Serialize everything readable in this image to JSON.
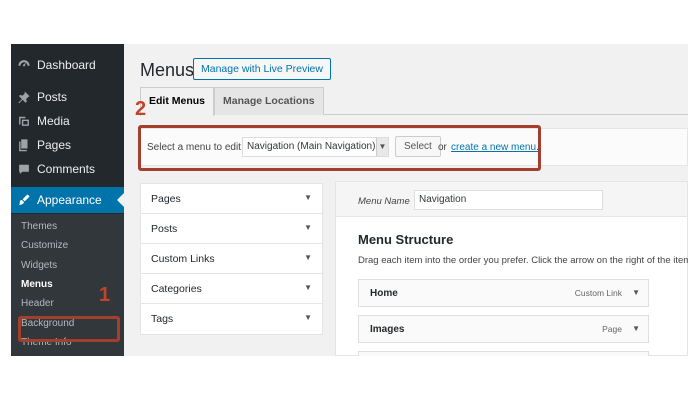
{
  "sidebar": {
    "items": [
      {
        "label": "Dashboard",
        "icon": "dashboard-icon"
      },
      {
        "label": "Posts",
        "icon": "pin-icon"
      },
      {
        "label": "Media",
        "icon": "media-icon"
      },
      {
        "label": "Pages",
        "icon": "pages-icon"
      },
      {
        "label": "Comments",
        "icon": "comments-icon"
      },
      {
        "label": "Appearance",
        "icon": "paintbrush-icon"
      }
    ],
    "submenu": [
      "Themes",
      "Customize",
      "Widgets",
      "Menus",
      "Header",
      "Background",
      "Theme Info"
    ]
  },
  "header": {
    "title": "Menus",
    "live_preview_button": "Manage with Live Preview"
  },
  "tabs": [
    "Edit Menus",
    "Manage Locations"
  ],
  "select_bar": {
    "label": "Select a menu to edit:",
    "selected_menu": "Navigation (Main Navigation)",
    "select_button": "Select",
    "or_text": "or",
    "create_link": "create a new menu",
    "create_link_suffix": "."
  },
  "accordion": [
    "Pages",
    "Posts",
    "Custom Links",
    "Categories",
    "Tags"
  ],
  "menu_edit": {
    "name_label": "Menu Name",
    "name_value": "Navigation",
    "structure_title": "Menu Structure",
    "structure_desc": "Drag each item into the order you prefer. Click the arrow on the right of the item",
    "items": [
      {
        "title": "Home",
        "type": "Custom Link"
      },
      {
        "title": "Images",
        "type": "Page"
      }
    ]
  },
  "annotations": {
    "step1": "1",
    "step2": "2"
  },
  "colors": {
    "sidebar_bg": "#23282d",
    "accent": "#0073aa",
    "annotation": "#a33f2c"
  }
}
